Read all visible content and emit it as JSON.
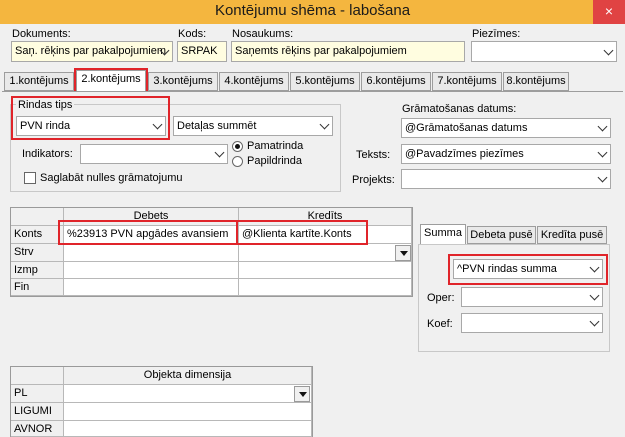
{
  "window": {
    "title": "Kontējumu shēma - labošana",
    "close_glyph": "×"
  },
  "header": {
    "dokuments_label": "Dokuments:",
    "dokuments_value": "Saņ. rēķins par pakalpojumiem",
    "kods_label": "Kods:",
    "kods_value": "SRPAK",
    "nosaukums_label": "Nosaukums:",
    "nosaukums_value": "Saņemts rēķins par pakalpojumiem",
    "piezimes_label": "Piezīmes:",
    "piezimes_value": ""
  },
  "tabs": [
    {
      "label": "1.kontējums",
      "active": false
    },
    {
      "label": "2.kontējums",
      "active": true
    },
    {
      "label": "3.kontējums",
      "active": false
    },
    {
      "label": "4.kontējums",
      "active": false
    },
    {
      "label": "5.kontējums",
      "active": false
    },
    {
      "label": "6.kontējums",
      "active": false
    },
    {
      "label": "7.kontējums",
      "active": false
    },
    {
      "label": "8.kontējums",
      "active": false
    }
  ],
  "rindas": {
    "tips_label": "Rindas tips",
    "tips_value": "PVN rinda",
    "detalas_value": "Detaļas summēt",
    "indikators_label": "Indikators:",
    "indikators_value": "",
    "pamatrinda_label": "Pamatrinda",
    "papildrinda_label": "Papildrinda",
    "selected": "Pamatrinda",
    "saglabat_label": "Saglabāt nulles grāmatojumu",
    "saglabat_checked": false
  },
  "right_fields": {
    "gramatosanas_label": "Grāmatošanas datums:",
    "gramatosanas_value": "@Grāmatošanas datums",
    "teksts_label": "Teksts:",
    "teksts_value": "@Pavadzīmes piezīmes",
    "projekts_label": "Projekts:",
    "projekts_value": ""
  },
  "posting_grid": {
    "columns": [
      "Debets",
      "Kredīts"
    ],
    "rows": [
      {
        "label": "Konts",
        "debets": "%23913 PVN apgādes avansiem",
        "kredits": "@Klienta kartīte.Konts"
      },
      {
        "label": "Strv",
        "debets": "",
        "kredits": ""
      },
      {
        "label": "Izmp",
        "debets": "",
        "kredits": ""
      },
      {
        "label": "Fin",
        "debets": "",
        "kredits": ""
      }
    ]
  },
  "summa_panel": {
    "tabs": [
      {
        "label": "Summa",
        "active": true
      },
      {
        "label": "Debeta pusē",
        "active": false
      },
      {
        "label": "Kredīta pusē",
        "active": false
      }
    ],
    "summa_value": "^PVN rindas summa",
    "oper_label": "Oper:",
    "oper_value": "",
    "koef_label": "Koef:",
    "koef_value": ""
  },
  "dimension_grid": {
    "header": "Objekta dimensija",
    "rows": [
      "PL",
      "LIGUMI",
      "AVNOR"
    ]
  },
  "colors": {
    "titlebar": "#f4b63f",
    "highlight": "#e0242a",
    "field_yellow": "#fffde0"
  }
}
